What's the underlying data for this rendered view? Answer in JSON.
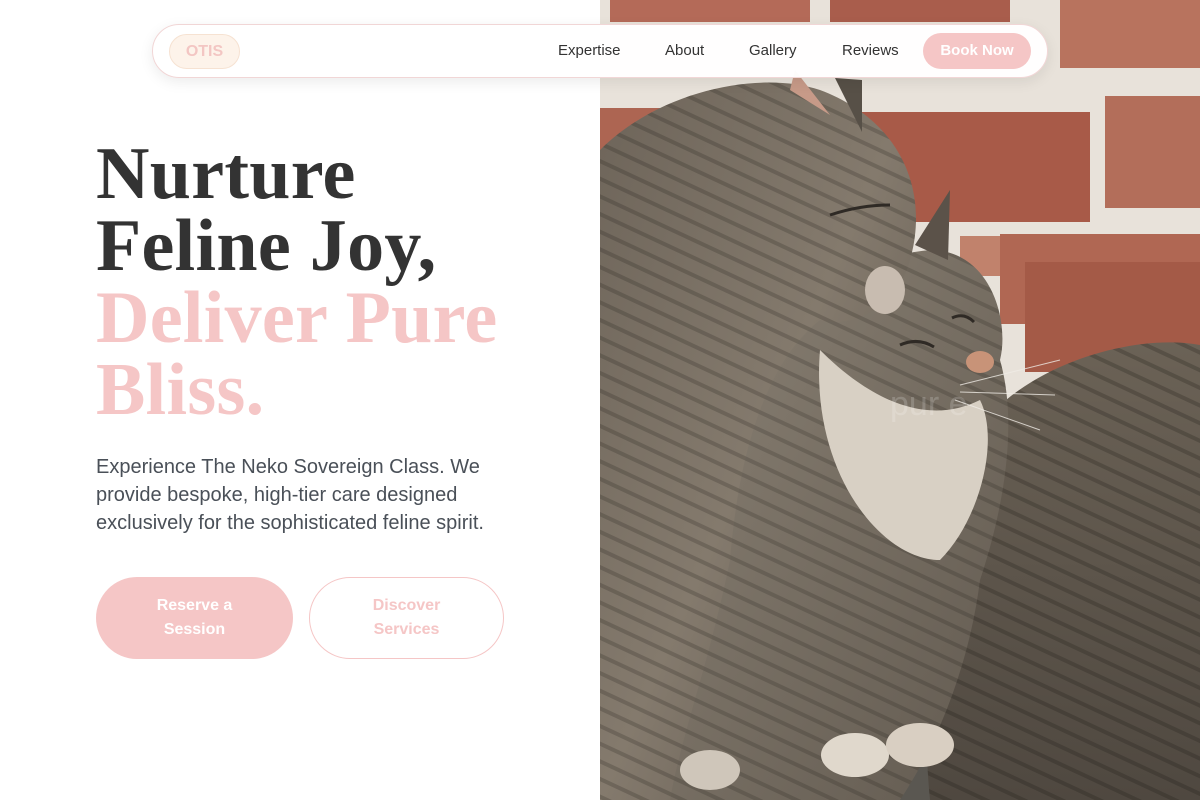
{
  "nav": {
    "logo": "OTIS",
    "links": [
      "Expertise",
      "About",
      "Gallery",
      "Reviews"
    ],
    "cta": "Book Now"
  },
  "hero": {
    "headline_dark": [
      "Nurture",
      "Feline Joy,"
    ],
    "headline_accent": [
      "Deliver Pure",
      "Bliss."
    ],
    "subtext": "Experience The Neko Sovereign Class. We provide bespoke, high-tier care designed exclusively for the sophisticated feline spirit.",
    "primary_button": "Reserve a Session",
    "secondary_button": "Discover Services"
  },
  "image": {
    "subject": "two tabby cats nuzzling",
    "background": "brick wall"
  },
  "colors": {
    "accent": "#f5c6c6",
    "text_dark": "#333333",
    "text_body": "#4a5058",
    "logo_bg": "#fdf3ea"
  },
  "icons": []
}
